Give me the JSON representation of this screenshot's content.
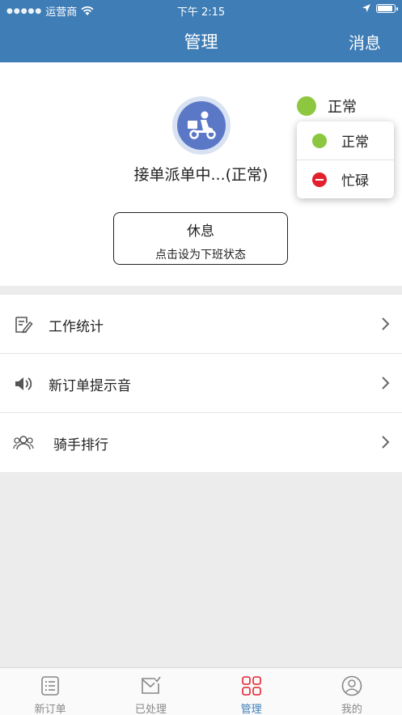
{
  "status_bar": {
    "carrier": "运营商",
    "time": "下午 2:15",
    "battery_level": 0.9
  },
  "nav": {
    "title": "管理",
    "action_label": "消息"
  },
  "profile": {
    "status_text": "接单派单中...(正常)",
    "rest_button": {
      "title": "休息",
      "subtitle": "点击设为下班状态"
    }
  },
  "status_selector": {
    "current": "正常",
    "current_color": "#8dc63f",
    "options": [
      {
        "label": "正常",
        "color": "#8dc63f",
        "icon": "green-dot-icon"
      },
      {
        "label": "忙碌",
        "color": "#e3202d",
        "icon": "busy-icon"
      }
    ]
  },
  "menu": {
    "items": [
      {
        "label": "工作统计",
        "icon": "edit-note-icon"
      },
      {
        "label": "新订单提示音",
        "icon": "speaker-icon"
      },
      {
        "label": "骑手排行",
        "icon": "users-icon"
      }
    ]
  },
  "tabs": {
    "active_color": "#3f7db6",
    "items": [
      {
        "label": "新订单",
        "icon": "list-icon"
      },
      {
        "label": "已处理",
        "icon": "checked-mail-icon"
      },
      {
        "label": "管理",
        "icon": "grid-icon"
      },
      {
        "label": "我的",
        "icon": "user-icon"
      }
    ]
  }
}
